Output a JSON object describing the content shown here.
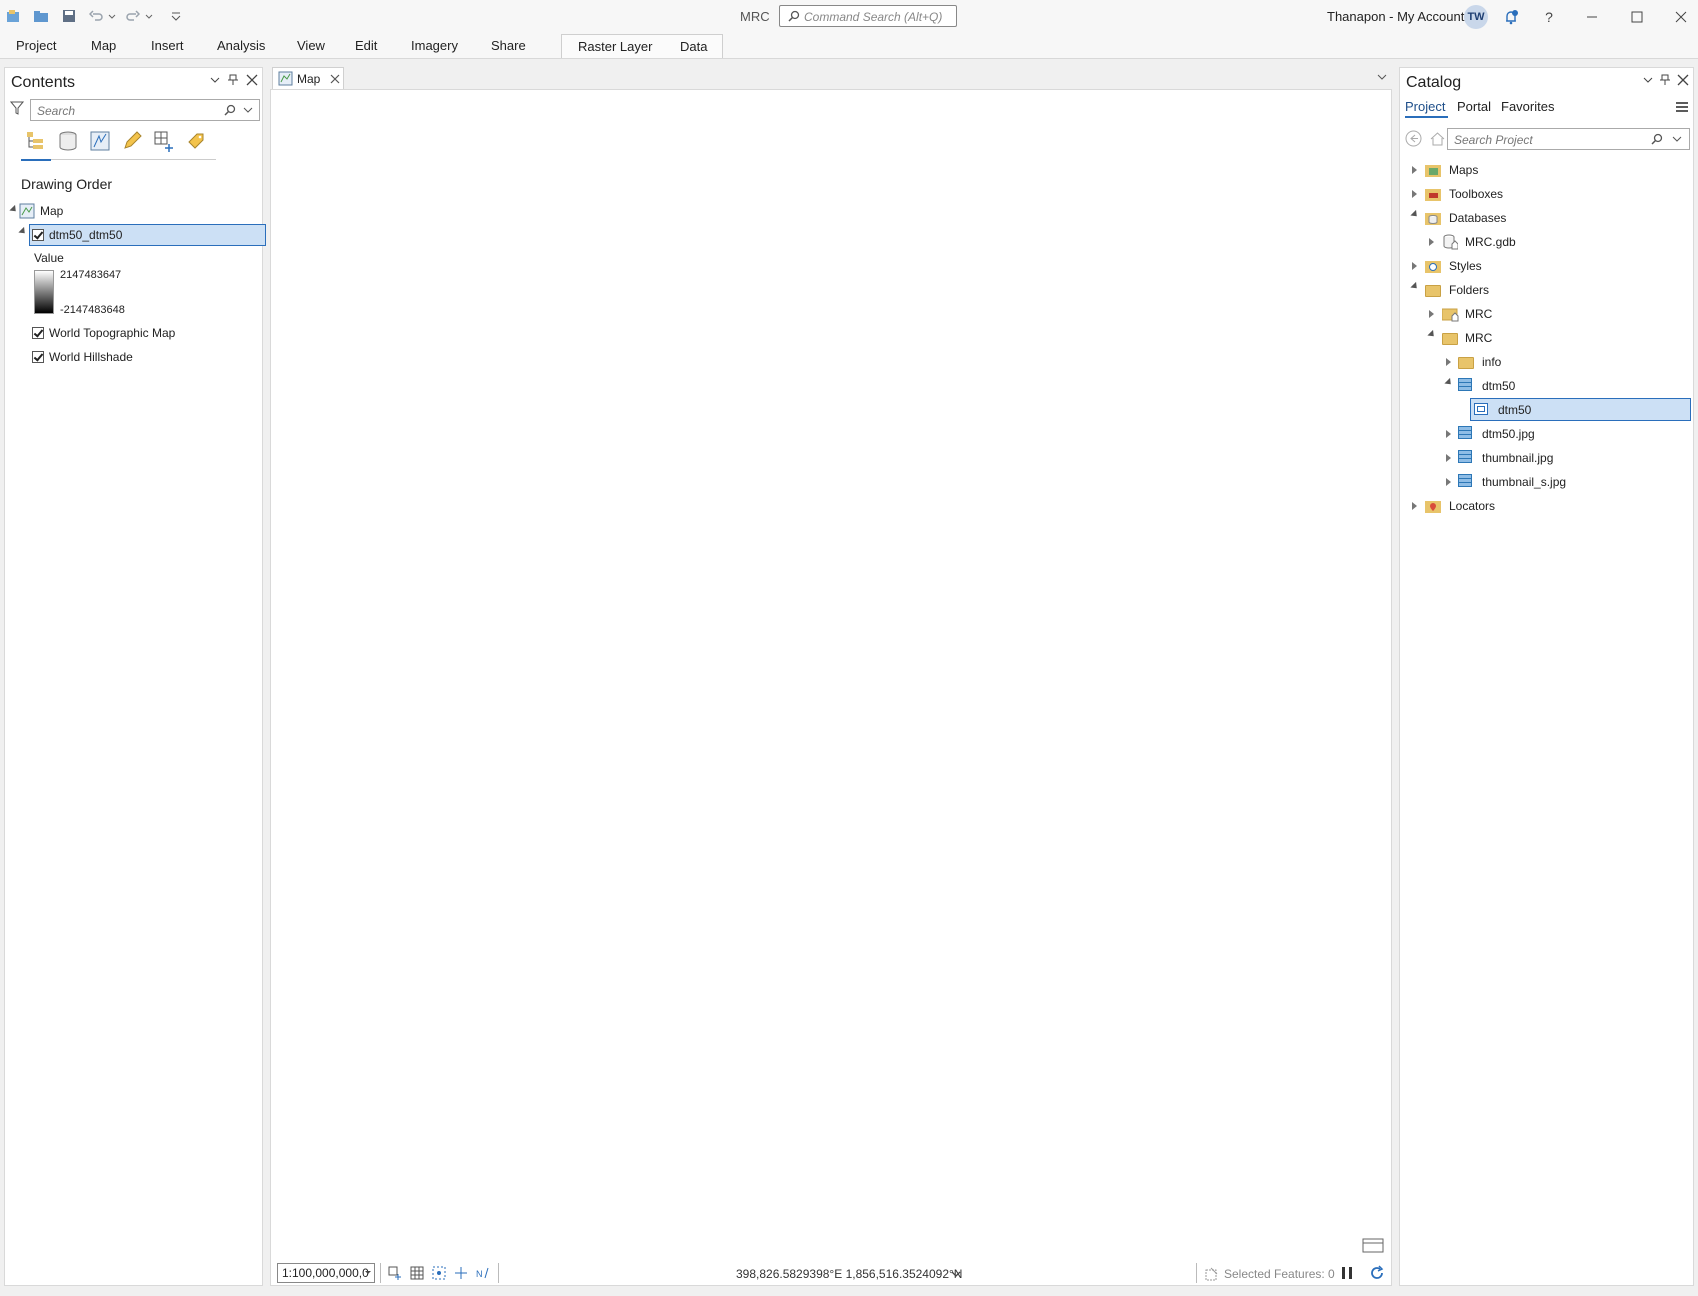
{
  "window": {
    "title": "MRC",
    "command_search_placeholder": "Command Search (Alt+Q)",
    "account": "Thanapon - My Account",
    "avatar_initials": "TW",
    "help": "?"
  },
  "ribbon": {
    "tabs": [
      "Project",
      "Map",
      "Insert",
      "Analysis",
      "View",
      "Edit",
      "Imagery",
      "Share"
    ],
    "contextual_tabs": [
      "Raster Layer",
      "Data"
    ]
  },
  "contents": {
    "title": "Contents",
    "search_placeholder": "Search",
    "section_title": "Drawing Order",
    "map_name": "Map",
    "layers": [
      {
        "name": "dtm50_dtm50",
        "checked": true,
        "selected": true
      },
      {
        "name": "World Topographic Map",
        "checked": true
      },
      {
        "name": "World Hillshade",
        "checked": true
      }
    ],
    "legend": {
      "label": "Value",
      "high": "2147483647",
      "low": "-2147483648"
    }
  },
  "map_view": {
    "tab_label": "Map",
    "scale": "1:100,000,000,0",
    "coordinates": "398,826.5829398°E 1,856,516.3524092°N",
    "selected_features": "Selected Features: 0"
  },
  "catalog": {
    "title": "Catalog",
    "tabs": [
      "Project",
      "Portal",
      "Favorites"
    ],
    "active_tab": "Project",
    "search_placeholder": "Search Project",
    "tree": [
      {
        "label": "Maps"
      },
      {
        "label": "Toolboxes"
      },
      {
        "label": "Databases"
      },
      {
        "label": "MRC.gdb"
      },
      {
        "label": "Styles"
      },
      {
        "label": "Folders"
      },
      {
        "label": "MRC"
      },
      {
        "label": "MRC"
      },
      {
        "label": "info"
      },
      {
        "label": "dtm50"
      },
      {
        "label": "dtm50"
      },
      {
        "label": "dtm50.jpg"
      },
      {
        "label": "thumbnail.jpg"
      },
      {
        "label": "thumbnail_s.jpg"
      },
      {
        "label": "Locators"
      }
    ]
  },
  "colors": {
    "accent": "#2a6ebb",
    "selection": "#cce0f5",
    "folder": "#e8c46a"
  }
}
